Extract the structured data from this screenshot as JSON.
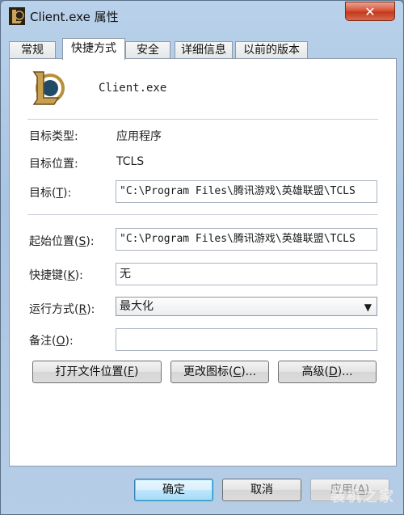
{
  "window": {
    "title": "Client.exe 属性",
    "close_symbol": "✕"
  },
  "tabs": [
    {
      "label": "常规"
    },
    {
      "label": "快捷方式",
      "active": true
    },
    {
      "label": "安全"
    },
    {
      "label": "详细信息"
    },
    {
      "label": "以前的版本"
    }
  ],
  "program": {
    "name": "Client.exe",
    "icon": "league-of-legends-icon"
  },
  "fields": {
    "target_type_label": "目标类型:",
    "target_type_value": "应用程序",
    "target_location_label": "目标位置:",
    "target_location_value": "TCLS",
    "target_label_pre": "目标(",
    "target_label_key": "T",
    "target_label_post": "):",
    "target_value": "\"C:\\Program Files\\腾讯游戏\\英雄联盟\\TCLS",
    "start_in_label_pre": "起始位置(",
    "start_in_label_key": "S",
    "start_in_label_post": "):",
    "start_in_value": "\"C:\\Program Files\\腾讯游戏\\英雄联盟\\TCLS",
    "shortcut_key_label_pre": "快捷键(",
    "shortcut_key_label_key": "K",
    "shortcut_key_label_post": "):",
    "shortcut_key_value": "无",
    "run_label_pre": "运行方式(",
    "run_label_key": "R",
    "run_label_post": "):",
    "run_value": "最大化",
    "comment_label_pre": "备注(",
    "comment_label_key": "O",
    "comment_label_post": "):",
    "comment_value": ""
  },
  "buttons": {
    "open_location_pre": "打开文件位置(",
    "open_location_key": "F",
    "open_location_post": ")",
    "change_icon_pre": "更改图标(",
    "change_icon_key": "C",
    "change_icon_post": ")...",
    "advanced_pre": "高级(",
    "advanced_key": "D",
    "advanced_post": ")...",
    "ok": "确定",
    "cancel": "取消",
    "apply_pre": "应用(",
    "apply_key": "A",
    "apply_post": ")"
  },
  "watermark": "装机之家",
  "colors": {
    "accent": "#3c7fb1",
    "close": "#c23a1f",
    "title_bg": "#b9d1ea"
  }
}
